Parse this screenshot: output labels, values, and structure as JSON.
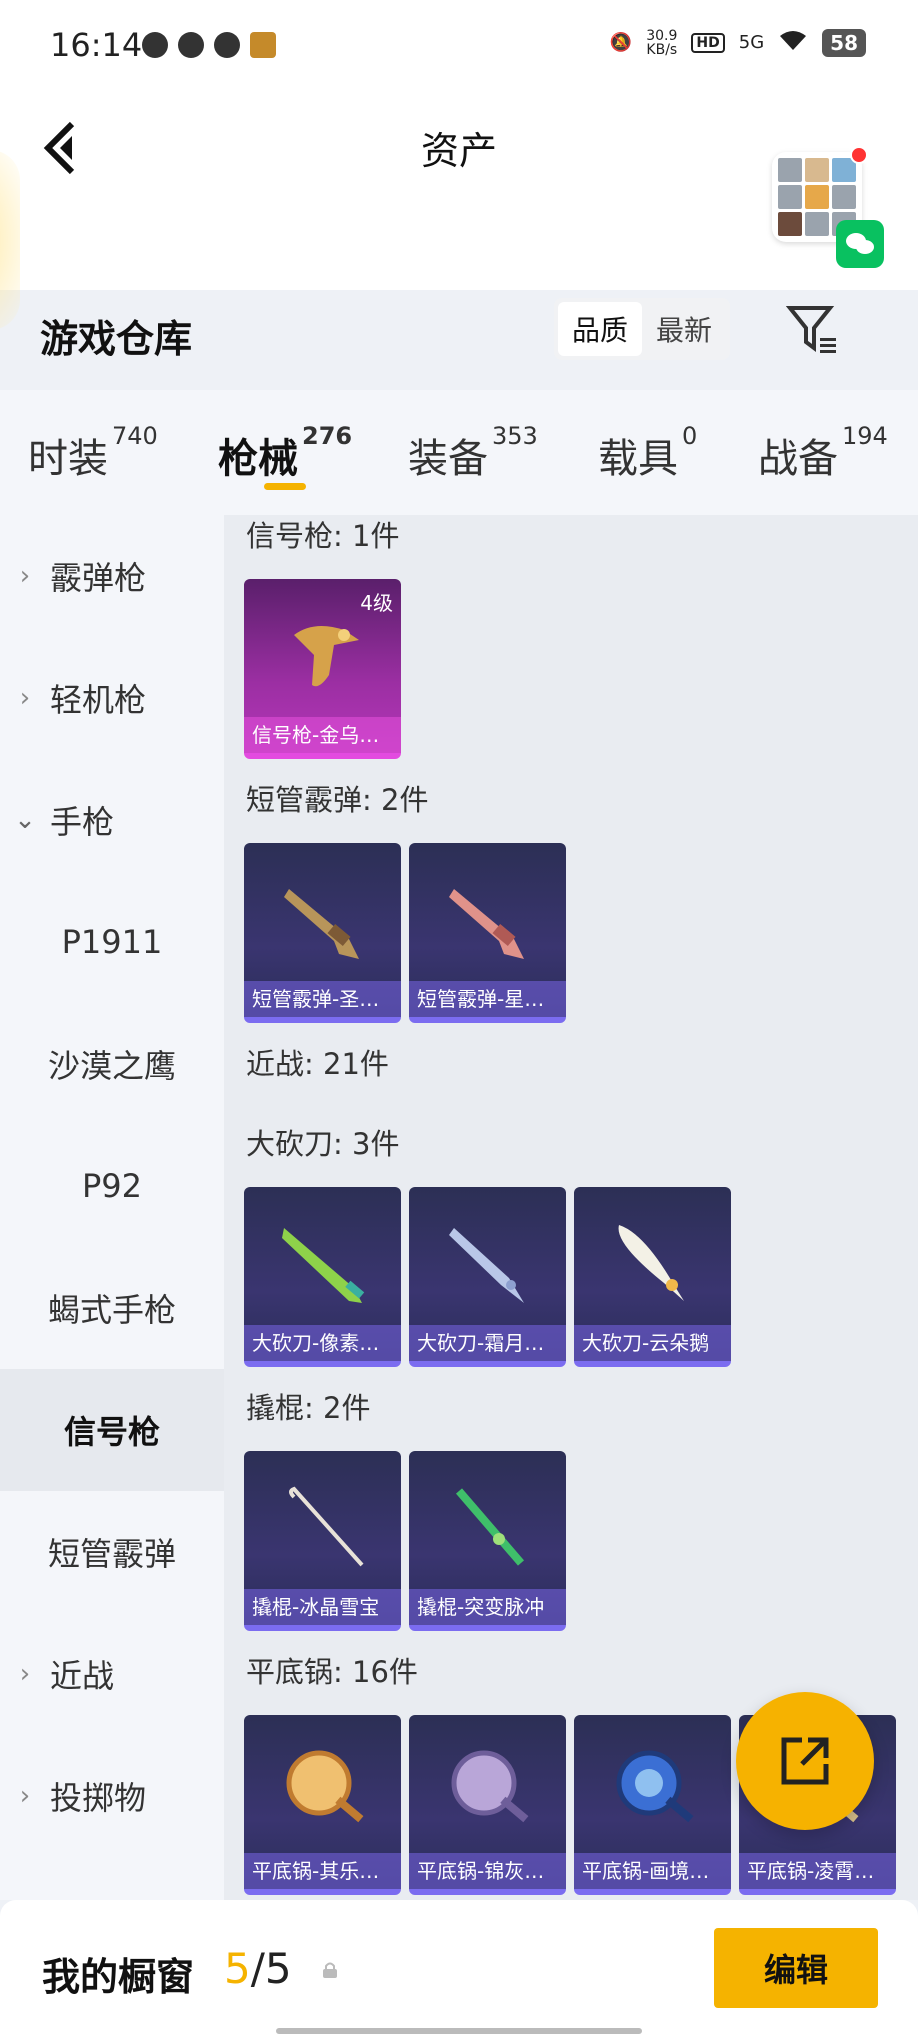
{
  "status_bar": {
    "time": "16:14",
    "speed_value": "30.9",
    "speed_unit": "KB/s",
    "hd": "HD",
    "network": "5G",
    "battery": "58"
  },
  "header": {
    "back_icon": "chevron-left-icon",
    "title": "资产"
  },
  "section": {
    "title": "游戏仓库",
    "sort_options": [
      "品质",
      "最新"
    ],
    "active_sort": "品质"
  },
  "tabs": [
    {
      "label": "时装",
      "count": "740"
    },
    {
      "label": "枪械",
      "count": "276"
    },
    {
      "label": "装备",
      "count": "353"
    },
    {
      "label": "载具",
      "count": "0"
    },
    {
      "label": "战备",
      "count": "194"
    }
  ],
  "active_tab": "枪械",
  "sidebar": [
    {
      "label": "霰弹枪",
      "type": "collapsed"
    },
    {
      "label": "轻机枪",
      "type": "collapsed"
    },
    {
      "label": "手枪",
      "type": "expanded"
    },
    {
      "label": "P1911",
      "type": "child"
    },
    {
      "label": "沙漠之鹰",
      "type": "child"
    },
    {
      "label": "P92",
      "type": "child"
    },
    {
      "label": "蝎式手枪",
      "type": "child"
    },
    {
      "label": "信号枪",
      "type": "child-active"
    },
    {
      "label": "短管霰弹",
      "type": "child"
    },
    {
      "label": "近战",
      "type": "collapsed"
    },
    {
      "label": "投掷物",
      "type": "collapsed"
    }
  ],
  "groups": [
    {
      "title": "信号枪: 1件",
      "items": [
        {
          "label": "信号枪-金乌…",
          "level": "4级",
          "rarity": "pink"
        }
      ]
    },
    {
      "title": "短管霰弹: 2件",
      "items": [
        {
          "label": "短管霰弹-圣…"
        },
        {
          "label": "短管霰弹-星…"
        }
      ]
    },
    {
      "title": "近战: 21件",
      "items": []
    },
    {
      "title": "大砍刀: 3件",
      "items": [
        {
          "label": "大砍刀-像素…"
        },
        {
          "label": "大砍刀-霜月…"
        },
        {
          "label": "大砍刀-云朵鹅"
        }
      ]
    },
    {
      "title": "撬棍: 2件",
      "items": [
        {
          "label": "撬棍-冰晶雪宝"
        },
        {
          "label": "撬棍-突变脉冲"
        }
      ]
    },
    {
      "title": "平底锅: 16件",
      "items": [
        {
          "label": "平底锅-其乐…"
        },
        {
          "label": "平底锅-锦灰…"
        },
        {
          "label": "平底锅-画境…"
        },
        {
          "label": "平底锅-凌霄…"
        }
      ]
    }
  ],
  "bottom_bar": {
    "label": "我的橱窗",
    "current": "5",
    "separator": "/",
    "total": "5",
    "edit_label": "编辑"
  },
  "colors": {
    "accent": "#f5b300",
    "pink_rarity": "#e34be0",
    "purple_rarity": "#7b6cf0"
  }
}
